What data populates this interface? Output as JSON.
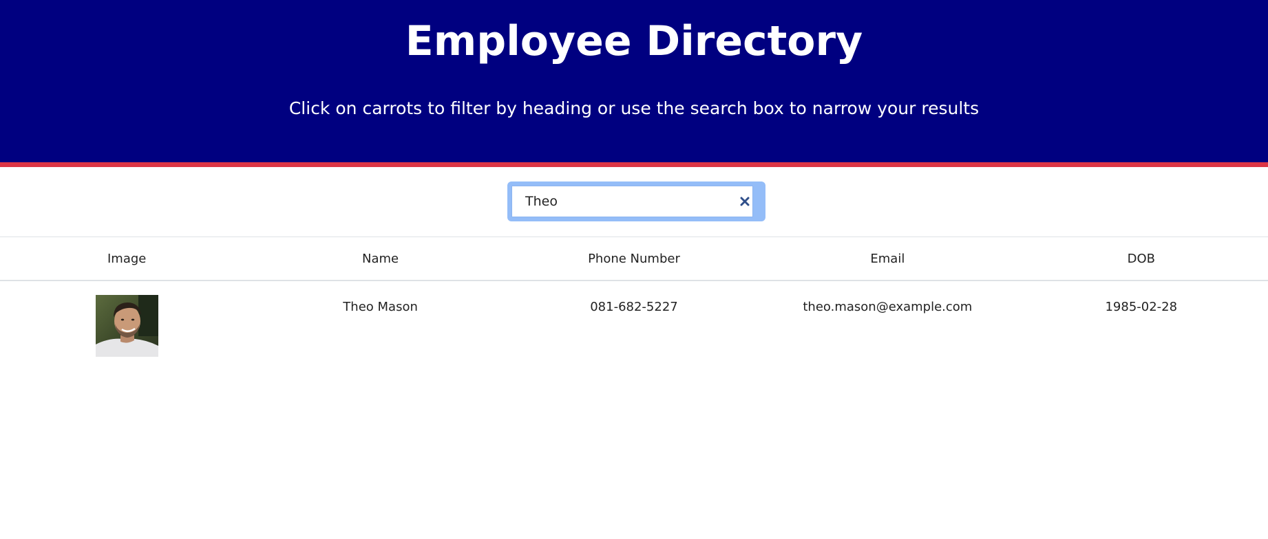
{
  "header": {
    "title": "Employee Directory",
    "subtitle": "Click on carrots to filter by heading or use the search box to narrow your results"
  },
  "search": {
    "value": "Theo",
    "placeholder": "",
    "clear_icon": "close-icon"
  },
  "table": {
    "columns": [
      "Image",
      "Name",
      "Phone Number",
      "Email",
      "DOB"
    ],
    "rows": [
      {
        "image_icon": "avatar",
        "name": "Theo Mason",
        "phone": "081-682-5227",
        "email": "theo.mason@example.com",
        "dob": "1985-02-28"
      }
    ]
  },
  "colors": {
    "hero_bg": "#000080",
    "hero_border": "#dc3545",
    "search_focus": "#94bdf8",
    "clear_icon": "#2f4f8a"
  }
}
